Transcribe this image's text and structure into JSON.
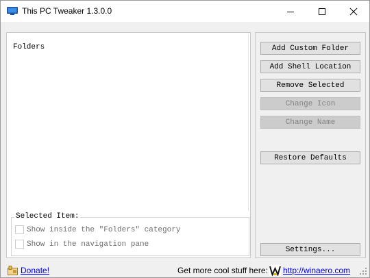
{
  "window": {
    "title": "This PC Tweaker 1.3.0.0",
    "controls": {
      "minimize": "minimize",
      "maximize": "maximize",
      "close": "close"
    }
  },
  "folders_panel": {
    "header": "Folders",
    "selected_item": {
      "title": "Selected Item:",
      "options": [
        {
          "label": "Show inside the \"Folders\" category",
          "checked": false,
          "enabled": false
        },
        {
          "label": "Show in the navigation pane",
          "checked": false,
          "enabled": false
        }
      ]
    }
  },
  "actions": {
    "add_custom_folder": "Add Custom Folder",
    "add_shell_location": "Add Shell Location",
    "remove_selected": "Remove Selected",
    "change_icon": "Change Icon",
    "change_name": "Change Name",
    "restore_defaults": "Restore Defaults",
    "settings": "Settings..."
  },
  "status_bar": {
    "donate": "Donate!",
    "more_text": "Get more cool stuff here:",
    "site": "http://winaero.com"
  },
  "icons": {
    "app": "this-pc-icon",
    "donate": "donate-icon",
    "winaero": "winaero-w-icon"
  },
  "colors": {
    "link": "#0000ee",
    "disabled_text": "#838383",
    "window_bg": "#f0f0f0"
  }
}
